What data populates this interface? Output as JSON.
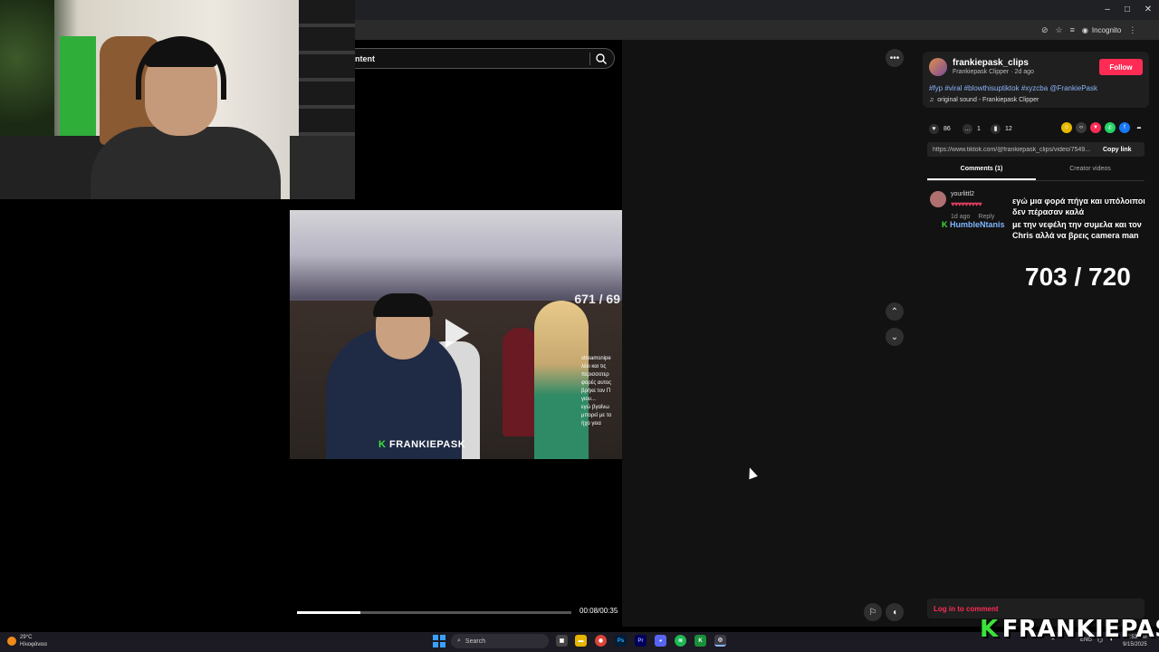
{
  "browser": {
    "incognito_label": "Incognito",
    "window_controls": [
      "–",
      "□",
      "✕"
    ]
  },
  "search": {
    "text": "ntent"
  },
  "video": {
    "overlay_counter": "671 / 69",
    "watermark_prefix": "K",
    "watermark": "FRANKIEPASK",
    "chat_lines": [
      "streamsnipe",
      "λέει και τις",
      "περισσοτερ",
      "φορές αυτος",
      "βρήκε τον Π",
      "γιου...",
      "εγώ βγαίνω",
      "μπορεί με το",
      "ήχο γεια"
    ],
    "time": "00:08/00:35",
    "progress_fraction": 0.23
  },
  "author": {
    "username": "frankiepask_clips",
    "subtitle": "Frankiepask Clipper · 2d ago",
    "follow_label": "Follow",
    "hashtags": "#fyp #viral #blowthisuptiktok #xyzcba @FrankiePask",
    "sound": "original sound - Frankiepask Clipper"
  },
  "stats": {
    "likes": "86",
    "comments": "1",
    "saves": "12"
  },
  "share": {
    "link": "https://www.tiktok.com/@frankiepask_clips/video/7549...",
    "copy_label": "Copy link"
  },
  "tabs": {
    "comments": "Comments (1)",
    "creator": "Creator videos"
  },
  "comment": {
    "user": "yourlittl2",
    "hearts": "♥♥♥♥♥♥♥♥♥",
    "time": "1d ago",
    "reply": "Reply"
  },
  "stream_overlay": {
    "line1": "εγώ μια φορά πήγα και υπόλοιποι δεν πέρασαν καλά",
    "user_prefix": "K",
    "user": "HumbleNtanis",
    "line2": "με την νεφέλη την συμελα και τον Chris αλλά να βρεις camera man",
    "counter": "703 / 720",
    "brand_k": "K",
    "brand": "FRANKIEPASK"
  },
  "login": {
    "label": "Log in to comment"
  },
  "taskbar": {
    "weather_temp": "29°C",
    "weather_desc": "Ηλιοφάνεια",
    "search_label": "Search",
    "lang": "ENG",
    "time": "7:53 PM",
    "date": "9/15/2025"
  }
}
